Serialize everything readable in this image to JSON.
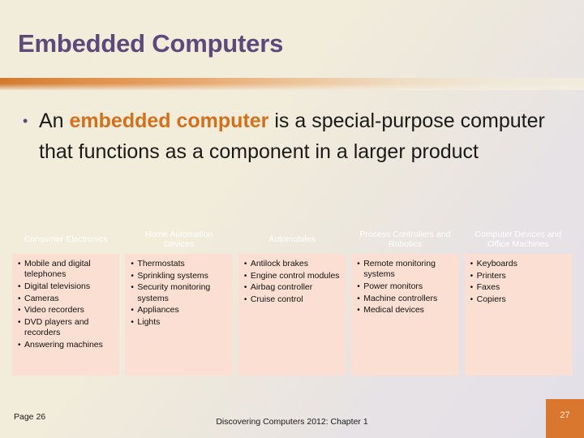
{
  "slide": {
    "title": "Embedded Computers",
    "bullet_marker": "•",
    "bullet": {
      "prefix": "An ",
      "highlight": "embedded computer",
      "suffix": " is a special-purpose computer that functions as a component in a larger product"
    }
  },
  "table": {
    "columns": [
      {
        "header": "Consumer Electronics",
        "items": [
          "Mobile and digital telephones",
          "Digital televisions",
          "Cameras",
          "Video recorders",
          "DVD players and recorders",
          "Answering machines"
        ]
      },
      {
        "header": "Home Automation Devices",
        "items": [
          "Thermostats",
          "Sprinkling systems",
          "Security monitoring systems",
          "Appliances",
          "Lights"
        ]
      },
      {
        "header": "Automobiles",
        "items": [
          "Antilock brakes",
          "Engine control modules",
          "Airbag controller",
          "Cruise control"
        ]
      },
      {
        "header": "Process Controllers and Robotics",
        "items": [
          "Remote monitoring systems",
          "Power monitors",
          "Machine controllers",
          "Medical devices"
        ]
      },
      {
        "header": "Computer Devices and Office Machines",
        "items": [
          "Keyboards",
          "Printers",
          "Faxes",
          "Copiers"
        ]
      }
    ]
  },
  "footer": {
    "page_label": "Page 26",
    "center_text": "Discovering Computers 2012: Chapter 1",
    "slide_number": "27"
  },
  "colors": {
    "title_purple": "#5f497a",
    "highlight_orange": "#d2701c",
    "header_orange": "#e98b38",
    "cell_peach": "#fadfd2",
    "slide_number_box": "#d9772e",
    "background_cream": "#f2ecdb",
    "background_lavender": "#e4e0e8"
  }
}
